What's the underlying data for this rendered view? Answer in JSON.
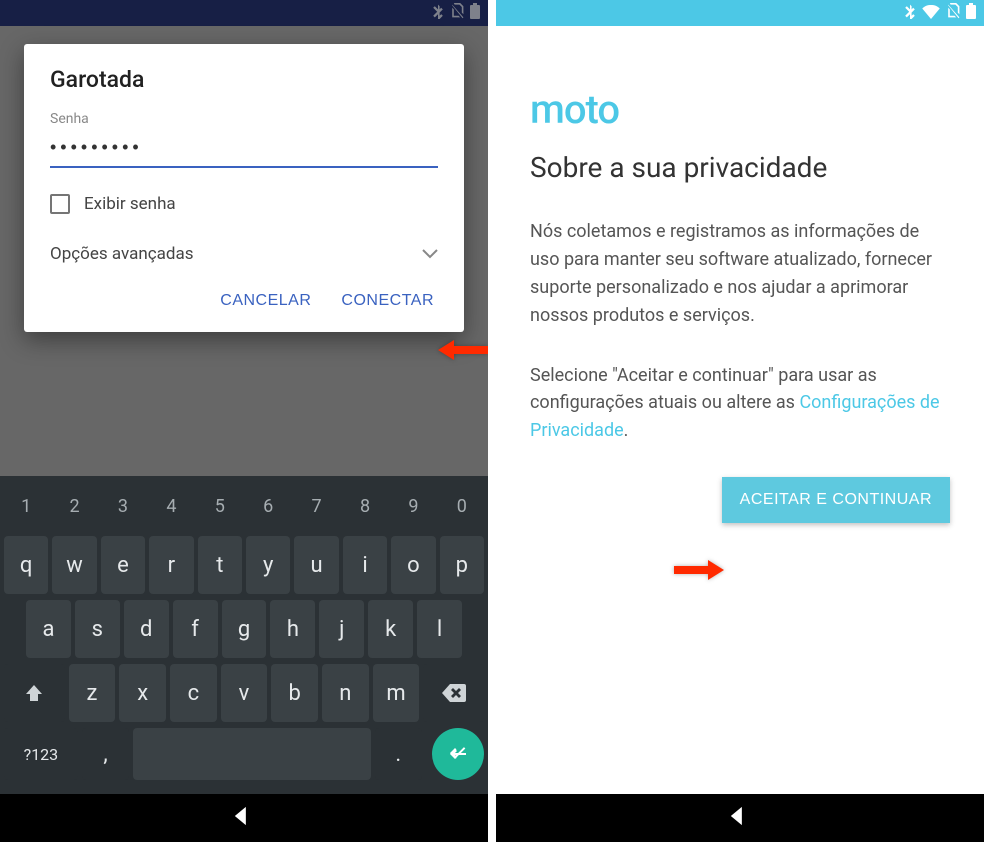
{
  "left": {
    "dialog": {
      "title": "Garotada",
      "password_label": "Senha",
      "password_value": "•••••••••",
      "show_password_label": "Exibir senha",
      "advanced_label": "Opções avançadas",
      "cancel": "CANCELAR",
      "connect": "CONECTAR"
    },
    "keyboard": {
      "numrow": [
        "1",
        "2",
        "3",
        "4",
        "5",
        "6",
        "7",
        "8",
        "9",
        "0"
      ],
      "row1": [
        "q",
        "w",
        "e",
        "r",
        "t",
        "y",
        "u",
        "i",
        "o",
        "p"
      ],
      "row2": [
        "a",
        "s",
        "d",
        "f",
        "g",
        "h",
        "j",
        "k",
        "l"
      ],
      "row3": [
        "z",
        "x",
        "c",
        "v",
        "b",
        "n",
        "m"
      ],
      "sym": "?123",
      "comma": ",",
      "period": "."
    }
  },
  "right": {
    "logo": "moto",
    "title": "Sobre a sua privacidade",
    "para1": "Nós coletamos e registramos as informações de uso para manter seu software atualizado, fornecer suporte personalizado e nos ajudar a aprimorar nossos produtos e serviços.",
    "para2_a": "Selecione \"Aceitar e continuar\" para usar as configurações atuais ou altere as ",
    "para2_link": "Configurações de Privacidade",
    "para2_b": ".",
    "accept": "ACEITAR E CONTINUAR"
  }
}
